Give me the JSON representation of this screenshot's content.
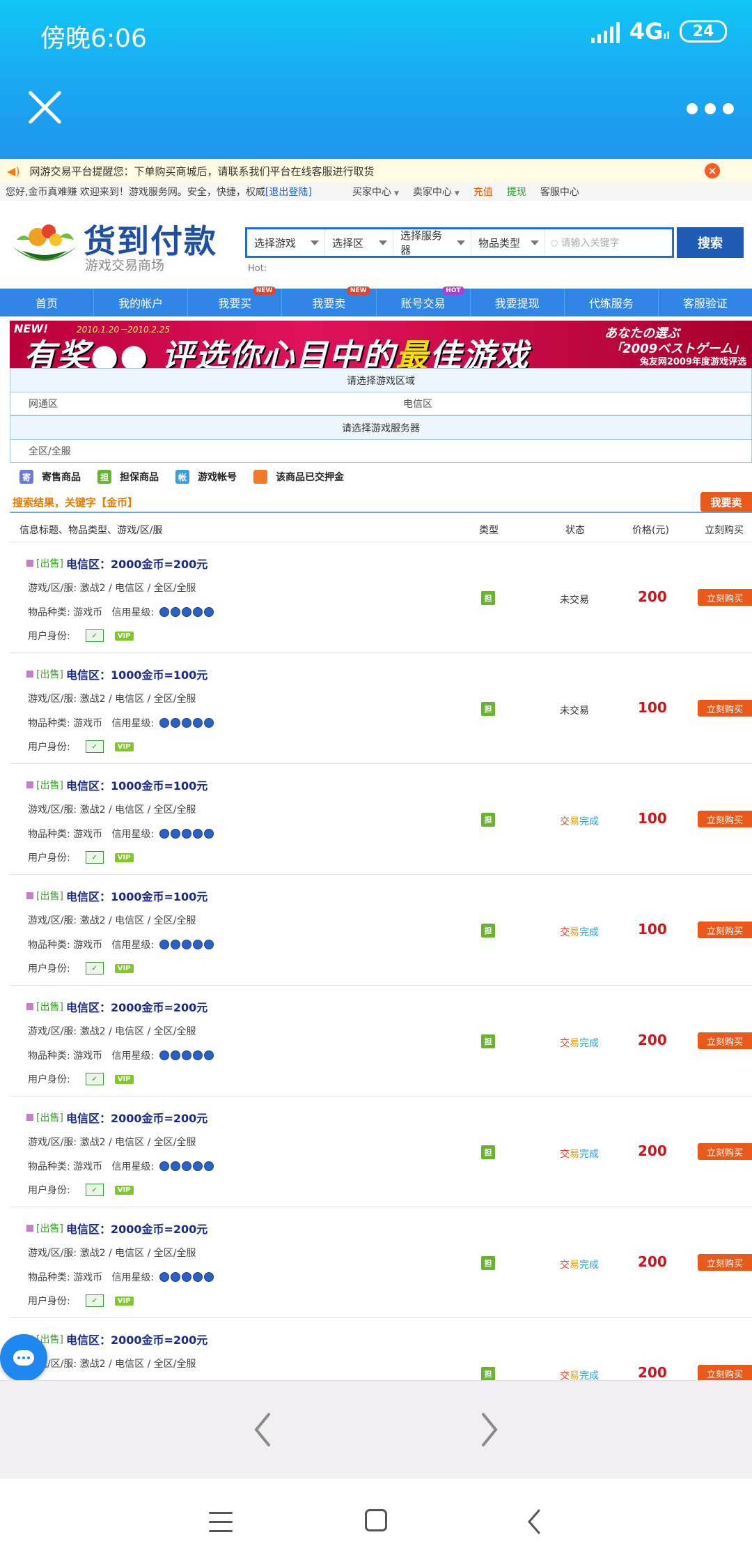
{
  "status": {
    "time": "傍晚6:06",
    "network": "4G",
    "battery": "24"
  },
  "notice": {
    "text": "网游交易平台提醒您：下单购买商城后，请联系我们平台在线客服进行取货"
  },
  "welcome": {
    "text": "您好,金币真难赚 欢迎来到！游戏服务网。安全，快捷，权威",
    "logout": "[退出登陆]",
    "buyer_center": "买家中心",
    "seller_center": "卖家中心",
    "recharge": "充值",
    "withdraw": "提现",
    "service_center": "客服中心"
  },
  "logo": {
    "title": "货到付款",
    "subtitle": "游戏交易商场"
  },
  "search": {
    "selects": [
      "选择游戏",
      "选择区",
      "选择服务器",
      "物品类型"
    ],
    "placeholder": "请输入关键字",
    "button": "搜索",
    "hot_label": "Hot:"
  },
  "nav": [
    {
      "label": "首页",
      "badge": ""
    },
    {
      "label": "我的帐户",
      "badge": ""
    },
    {
      "label": "我要买",
      "badge": "NEW"
    },
    {
      "label": "我要卖",
      "badge": "NEW"
    },
    {
      "label": "账号交易",
      "badge": "HOT"
    },
    {
      "label": "我要提现",
      "badge": ""
    },
    {
      "label": "代练服务",
      "badge": ""
    },
    {
      "label": "客服验证",
      "badge": ""
    }
  ],
  "banner": {
    "new_tag": "NEW!",
    "date": "2010.1.20－2010.2.25",
    "main_a": "有奖",
    "main_b": "评选你心目中的",
    "main_hl": "最",
    "main_c": "佳游戏",
    "jp1": "あなたの選ぶ",
    "jp2": "「2009ベストゲーム」",
    "sub": "兔友网2009年度游戏评选"
  },
  "zones": {
    "area_head": "请选择游戏区域",
    "area_options": [
      "网通区",
      "电信区"
    ],
    "server_head": "请选择游戏服务器",
    "server_options": [
      "全区/全服"
    ]
  },
  "legend": [
    {
      "icon": "寄",
      "label": "寄售商品",
      "color": "#6a7bd6"
    },
    {
      "icon": "担",
      "label": "担保商品",
      "color": "#68b42e"
    },
    {
      "icon": "帐",
      "label": "游戏帐号",
      "color": "#3a9ee0"
    },
    {
      "icon": "",
      "label": "该商品已交押金",
      "color": "#f07a2a"
    }
  ],
  "results": {
    "title": "搜索结果，关键字【金币】",
    "sell_button": "我要卖",
    "columns": [
      "信息标题、物品类型、游戏/区/服",
      "类型",
      "状态",
      "价格(元)",
      "立刻购买"
    ]
  },
  "listing_labels": {
    "sale_tag": "[出售]",
    "game_label": "游戏/区/服:",
    "game_value": "激战2 / 电信区 / 全区/全服",
    "kind_label": "物品种类:",
    "kind_value": "游戏币",
    "credit_label": "信用星级:",
    "user_label": "用户身份:",
    "vip": "VIP",
    "type_icon": "担",
    "buy_button": "立刻购买"
  },
  "listings": [
    {
      "title": "电信区：2000金币=200元",
      "status": "未交易",
      "price": "200"
    },
    {
      "title": "电信区：1000金币=100元",
      "status": "未交易",
      "price": "100"
    },
    {
      "title": "电信区：1000金币=100元",
      "status": "交易完成",
      "price": "100"
    },
    {
      "title": "电信区：1000金币=100元",
      "status": "交易完成",
      "price": "100"
    },
    {
      "title": "电信区：2000金币=200元",
      "status": "交易完成",
      "price": "200"
    },
    {
      "title": "电信区：2000金币=200元",
      "status": "交易完成",
      "price": "200"
    },
    {
      "title": "电信区：2000金币=200元",
      "status": "交易完成",
      "price": "200"
    },
    {
      "title": "电信区：2000金币=200元",
      "status": "交易完成",
      "price": "200"
    }
  ],
  "colors": {
    "topbar": "#10c6f6",
    "nav": "#2f86e6",
    "accent": "#e8591a",
    "price": "#d4121a"
  }
}
